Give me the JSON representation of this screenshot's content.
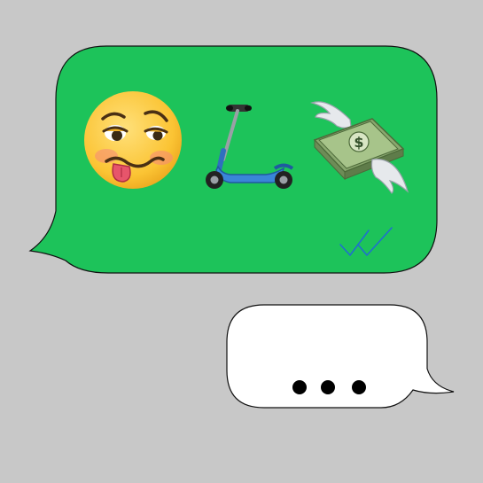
{
  "app": {
    "type": "chat-thread"
  },
  "colors": {
    "background": "#c8c8c8",
    "outgoing_bubble": "#1dc35a",
    "incoming_bubble": "#ffffff",
    "read_receipt": "#1f6fcf",
    "typing_dots": "#000000"
  },
  "messages": [
    {
      "direction": "incoming",
      "kind": "emoji",
      "emojis": [
        "woozy-face",
        "kick-scooter",
        "money-with-wings"
      ],
      "status": "read",
      "status_icon": "double-check-icon"
    },
    {
      "direction": "outgoing",
      "kind": "typing-indicator",
      "dots": 3
    }
  ]
}
